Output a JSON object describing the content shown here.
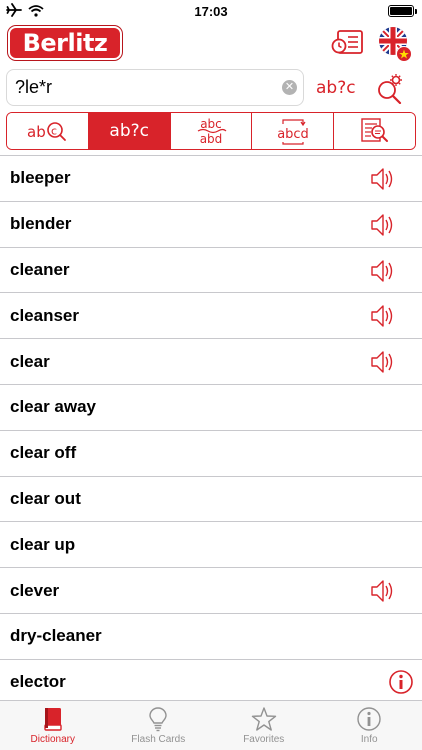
{
  "status": {
    "time": "17:03"
  },
  "app": {
    "brand": "Berlitz"
  },
  "search": {
    "value": "?le*r",
    "pattern_label": "ab?c"
  },
  "modes": [
    {
      "label": "ab",
      "icon": "letter-search-icon"
    },
    {
      "label": "ab?c",
      "active": true
    },
    {
      "icon": "anagram-icon",
      "top": "abc",
      "bottom": "abd"
    },
    {
      "icon": "word-swap-icon",
      "label": "abcd"
    },
    {
      "icon": "fulltext-search-icon"
    }
  ],
  "words": [
    {
      "text": "bleeper",
      "aux": "audio"
    },
    {
      "text": "blender",
      "aux": "audio"
    },
    {
      "text": "cleaner",
      "aux": "audio"
    },
    {
      "text": "cleanser",
      "aux": "audio"
    },
    {
      "text": "clear",
      "aux": "audio"
    },
    {
      "text": "clear away",
      "aux": ""
    },
    {
      "text": "clear off",
      "aux": ""
    },
    {
      "text": "clear out",
      "aux": ""
    },
    {
      "text": "clear up",
      "aux": ""
    },
    {
      "text": "clever",
      "aux": "audio"
    },
    {
      "text": "dry-cleaner",
      "aux": ""
    },
    {
      "text": "elector",
      "aux": "info"
    }
  ],
  "tabs": [
    {
      "label": "Dictionary",
      "icon": "book-icon",
      "active": true
    },
    {
      "label": "Flash Cards",
      "icon": "lightbulb-icon"
    },
    {
      "label": "Favorites",
      "icon": "star-icon"
    },
    {
      "label": "Info",
      "icon": "info-icon"
    }
  ],
  "colors": {
    "accent": "#d8232a",
    "tab_inactive": "#929292",
    "separator": "#c8c8cc"
  }
}
